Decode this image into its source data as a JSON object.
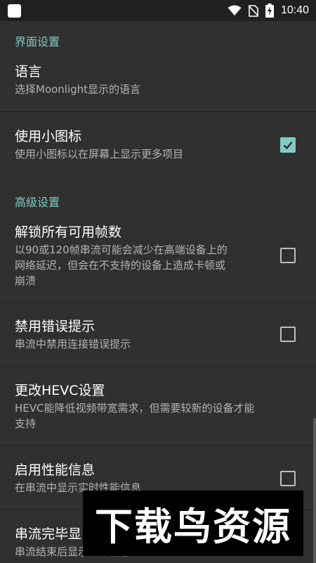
{
  "status_bar": {
    "time": "10:40",
    "icons": [
      "app-notification-icon",
      "wifi-icon",
      "no-sim-icon",
      "battery-charging-icon"
    ]
  },
  "sections": {
    "interface": {
      "header": "界面设置"
    },
    "advanced": {
      "header": "高级设置"
    }
  },
  "prefs": {
    "language": {
      "title": "语言",
      "summary": "选择Moonlight显示的语言"
    },
    "small_icons": {
      "title": "使用小图标",
      "summary": "使用小图标以在屏幕上显示更多项目",
      "checked": true
    },
    "unlock_fps": {
      "title": "解锁所有可用帧数",
      "summary_line1": "以90或120帧串流可能会减少在高端设备上的",
      "summary_line2": "网络延迟，但会在不支持的设备上造成卡顿或",
      "summary_line3": "崩溃",
      "checked": false
    },
    "disable_warnings": {
      "title": "禁用错误提示",
      "summary": "串流中禁用连接错误提示",
      "checked": false
    },
    "hevc": {
      "title": "更改HEVC设置",
      "summary_line1": "HEVC能降低视频带宽需求，但需要较新的设备才能",
      "summary_line2": "支持"
    },
    "perf_overlay": {
      "title": "启用性能信息",
      "summary": "在串流中显示实时性能信息",
      "checked": false
    },
    "stream_end": {
      "title": "串流完毕显",
      "summary": "串流结束后显示延迟信息"
    }
  },
  "watermark": {
    "text": "下载鸟资源"
  },
  "colors": {
    "accent": "#80cbc4",
    "background": "#303030",
    "status_bar": "#202020"
  }
}
